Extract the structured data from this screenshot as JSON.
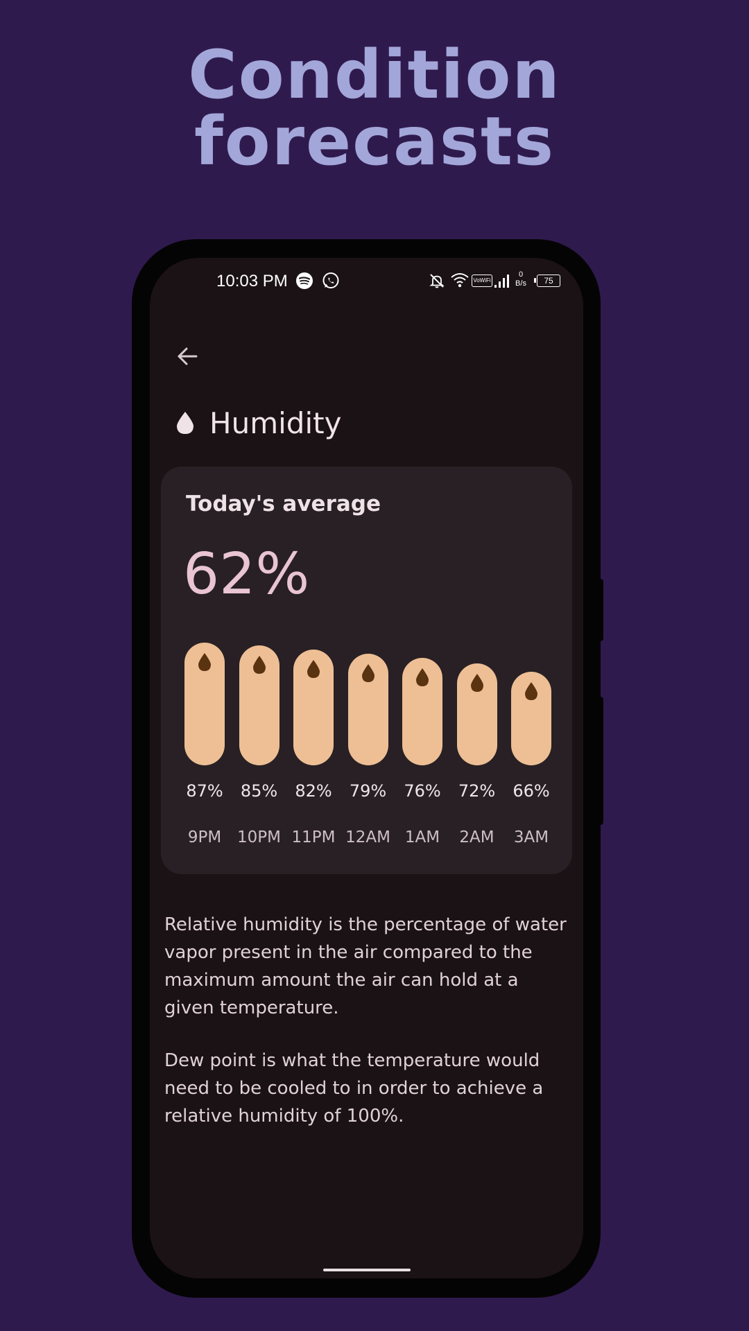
{
  "promo": {
    "headline_line1": "Condition",
    "headline_line2": "forecasts"
  },
  "status_bar": {
    "time": "10:03 PM",
    "net_speed_top": "0",
    "net_speed_bottom": "B/s",
    "volte_label": "VoWiFi",
    "battery": "75",
    "icons": [
      "spotify-icon",
      "whatsapp-icon",
      "bell-off-icon",
      "wifi-icon",
      "vowifi-icon",
      "signal-icon",
      "battery-icon"
    ]
  },
  "header": {
    "back_icon": "arrow-left-icon",
    "title_icon": "water-drop-icon",
    "title": "Humidity"
  },
  "card": {
    "label": "Today's average",
    "value": "62%"
  },
  "chart_data": {
    "type": "bar",
    "categories": [
      "9PM",
      "10PM",
      "11PM",
      "12AM",
      "1AM",
      "2AM",
      "3AM"
    ],
    "values": [
      87,
      85,
      82,
      79,
      76,
      72,
      66
    ],
    "value_labels": [
      "87%",
      "85%",
      "82%",
      "79%",
      "76%",
      "72%",
      "66%"
    ],
    "unit": "%",
    "bar_color": "#eebf95",
    "icon_color": "#5a3310"
  },
  "description": {
    "p1": "Relative humidity is the percentage of water vapor present in the air compared to the maximum amount the air can hold at a given temperature.",
    "p2": "Dew point is what the temperature would need to be cooled to in order to achieve a relative humidity of 100%."
  },
  "colors": {
    "page_background": "#2f1a4e",
    "headline": "#a3a6d8",
    "screen_background": "#1b1216",
    "card_background": "#282024",
    "accent_value": "#e9c4d2"
  }
}
